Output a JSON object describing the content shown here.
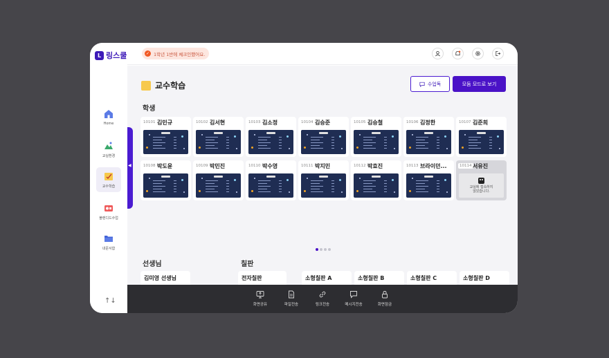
{
  "app": {
    "name": "링스쿨",
    "logo_mark": "L"
  },
  "sidebar": {
    "items": [
      {
        "label": "Home",
        "icon": "home-icon"
      },
      {
        "label": "교실환경",
        "icon": "classroom-env-icon"
      },
      {
        "label": "교수학습",
        "icon": "teaching-icon",
        "active": true
      },
      {
        "label": "블렌디드수업",
        "icon": "blended-class-icon"
      },
      {
        "label": "내문서함",
        "icon": "my-documents-icon"
      }
    ],
    "collapse_arrow": "◀",
    "sort_glyph": "↑↓"
  },
  "topbar": {
    "checkin_message": "1학년 1반에 체크인했어요.",
    "check_glyph": "✓",
    "icons": [
      "user-icon",
      "bell-icon",
      "settings-icon",
      "logout-icon"
    ]
  },
  "page": {
    "title": "교수학습",
    "class_note_button": "수업독",
    "group_mode_button": "모둠 모드로 보기"
  },
  "students": {
    "section_title": "학생",
    "items": [
      {
        "num": "10101",
        "name": "김민규"
      },
      {
        "num": "10102",
        "name": "김서현"
      },
      {
        "num": "10103",
        "name": "김소정"
      },
      {
        "num": "10104",
        "name": "김승준"
      },
      {
        "num": "10105",
        "name": "김승철"
      },
      {
        "num": "10106",
        "name": "김정한"
      },
      {
        "num": "10107",
        "name": "김준희"
      },
      {
        "num": "10108",
        "name": "박도윤"
      },
      {
        "num": "10109",
        "name": "박민진"
      },
      {
        "num": "10110",
        "name": "박수영"
      },
      {
        "num": "10111",
        "name": "박지민"
      },
      {
        "num": "10112",
        "name": "박효진"
      },
      {
        "num": "10113",
        "name": "브라이던..."
      },
      {
        "num": "10114",
        "name": "서유진",
        "offline_line1": "교실에 접속하지",
        "offline_line2": "않았습니다."
      }
    ],
    "pager": {
      "pages": 4,
      "current": 1
    }
  },
  "teacher": {
    "section_title": "선생님",
    "name": "김미영 선생님"
  },
  "boards": {
    "section_title": "칠판",
    "items": [
      {
        "name": "전자칠판"
      },
      {
        "name": "소형칠판 A"
      },
      {
        "name": "소형칠판 B"
      },
      {
        "name": "소형칠판 C"
      },
      {
        "name": "소형칠판 D"
      }
    ],
    "pager": {
      "pages": 4,
      "current": 1
    }
  },
  "toolbar": {
    "items": [
      {
        "label": "화면공유",
        "icon": "screen-share-icon"
      },
      {
        "label": "파일전송",
        "icon": "file-send-icon"
      },
      {
        "label": "링크전송",
        "icon": "link-send-icon"
      },
      {
        "label": "메시지전송",
        "icon": "message-send-icon"
      },
      {
        "label": "화면잠금",
        "icon": "screen-lock-icon"
      }
    ]
  },
  "colors": {
    "accent": "#4a12c7",
    "background": "#46454a",
    "thumb_bg": "#1f2d53",
    "checkin_bg": "#fde6df",
    "toolbar_bg": "#2d2d31"
  }
}
